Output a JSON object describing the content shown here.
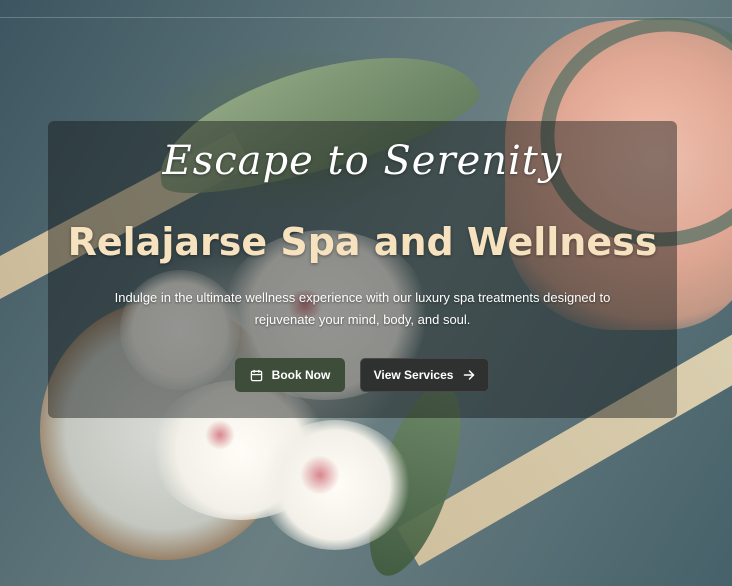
{
  "hero": {
    "tagline": "Escape to Serenity",
    "title": "Relajarse Spa and Wellness",
    "description": "Indulge in the ultimate wellness experience with our luxury spa treatments designed to rejuvenate your mind, body, and soul.",
    "buttons": {
      "book_label": "Book Now",
      "book_icon": "calendar-icon",
      "view_label": "View Services",
      "view_icon": "arrow-right-icon"
    }
  },
  "colors": {
    "title": "#f7e2c0",
    "book_button": "#3e4c3a",
    "view_button": "#2f3131",
    "overlay": "rgba(18,22,22,0.45)"
  }
}
